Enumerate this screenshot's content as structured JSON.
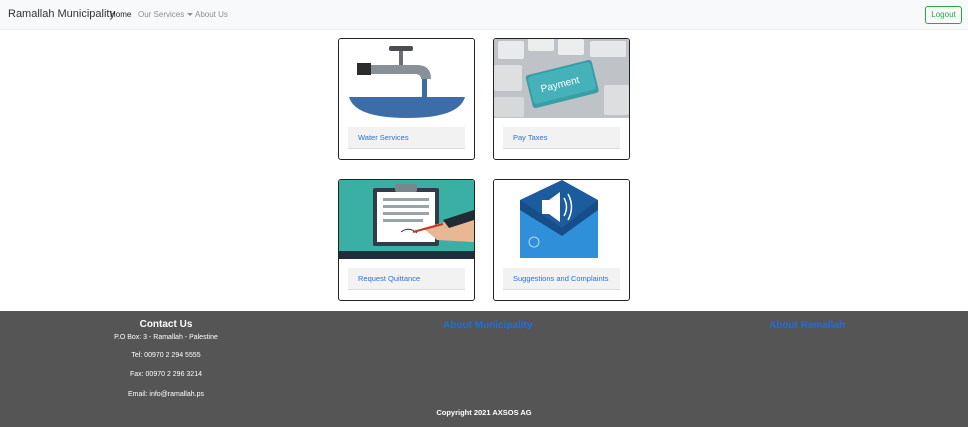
{
  "navbar": {
    "brand": "Ramallah Municipality",
    "home": "Home",
    "services": "Our Services",
    "about": "About Us",
    "logout": "Logout"
  },
  "services": [
    {
      "label": "Water Services",
      "icon": "water-tap-image"
    },
    {
      "label": "Pay Taxes",
      "icon": "payment-key-image"
    },
    {
      "label": "Request Quittance",
      "icon": "clipboard-sign-image"
    },
    {
      "label": "Suggestions and Complaints",
      "icon": "envelope-megaphone-image"
    }
  ],
  "payment_key_text": "Payment",
  "footer": {
    "contact_title": "Contact Us",
    "po_box": "P.O Box: 3 - Ramallah - Palestine",
    "tel": "Tel: 00970 2 294 5555",
    "fax": "Fax: 00970 2 296 3214",
    "email": "Email: info@ramallah.ps",
    "about_municipality": "About Municipality",
    "about_ramallah": "About Ramallah",
    "copyright": "Copyright 2021 AXSOS AG"
  },
  "colors": {
    "accent_link": "#2a72d8",
    "logout": "#28a745",
    "footer_bg": "#555555"
  }
}
